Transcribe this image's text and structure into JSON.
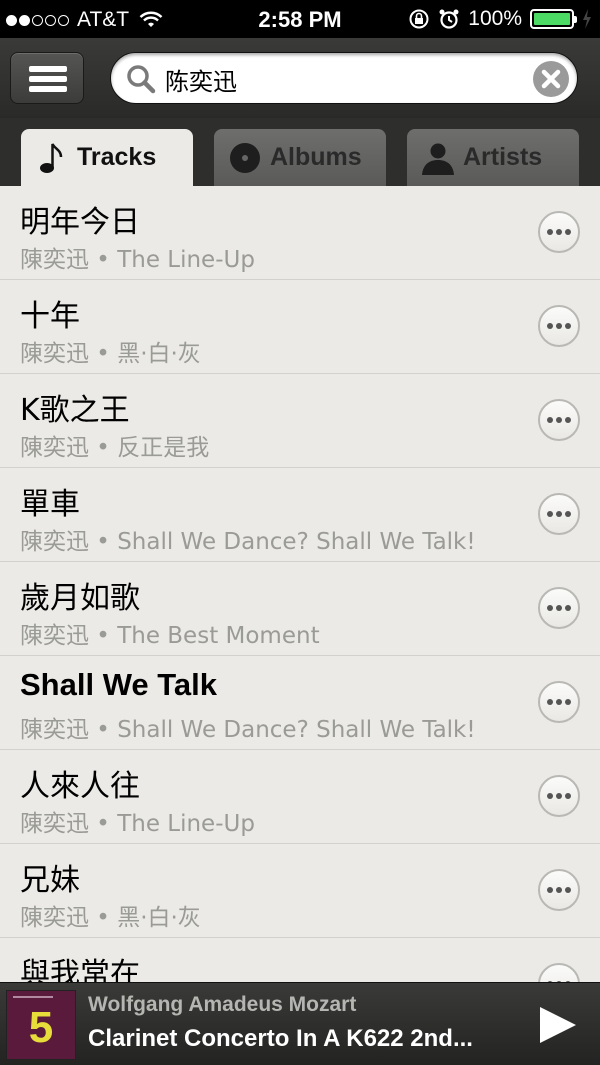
{
  "status_bar": {
    "carrier": "AT&T",
    "time": "2:58 PM",
    "battery": "100%",
    "battery_color": "#4cd964"
  },
  "header": {
    "menu_icon": "hamburger-icon",
    "search": {
      "value": "陈奕迅",
      "icon": "search-icon",
      "clear_icon": "clear-icon"
    }
  },
  "tabs": [
    {
      "label": "Tracks",
      "icon": "music-note-icon",
      "active": true
    },
    {
      "label": "Albums",
      "icon": "disc-icon",
      "active": false
    },
    {
      "label": "Artists",
      "icon": "person-icon",
      "active": false
    }
  ],
  "tracks": [
    {
      "title": "明年今日",
      "subtitle": "陳奕迅 • The Line-Up"
    },
    {
      "title": "十年",
      "subtitle": "陳奕迅 • 黑·白·灰"
    },
    {
      "title": "K歌之王",
      "subtitle": "陳奕迅 • 反正是我"
    },
    {
      "title": "單車",
      "subtitle": "陳奕迅 • Shall We Dance? Shall We Talk!"
    },
    {
      "title": "歲月如歌",
      "subtitle": "陳奕迅 • The Best Moment"
    },
    {
      "title": "Shall We Talk",
      "subtitle": "陳奕迅 • Shall We Dance? Shall We Talk!"
    },
    {
      "title": "人來人往",
      "subtitle": "陳奕迅 • The Line-Up"
    },
    {
      "title": "兄妹",
      "subtitle": "陳奕迅 • 黑·白·灰"
    },
    {
      "title": "與我常在",
      "subtitle": ""
    }
  ],
  "now_playing": {
    "artist": "Wolfgang Amadeus Mozart",
    "track": "Clarinet Concerto In A K622 2nd...",
    "cover_text": "5",
    "cover_color": "#5a1a3c",
    "accent_color": "#e6dc3a"
  }
}
